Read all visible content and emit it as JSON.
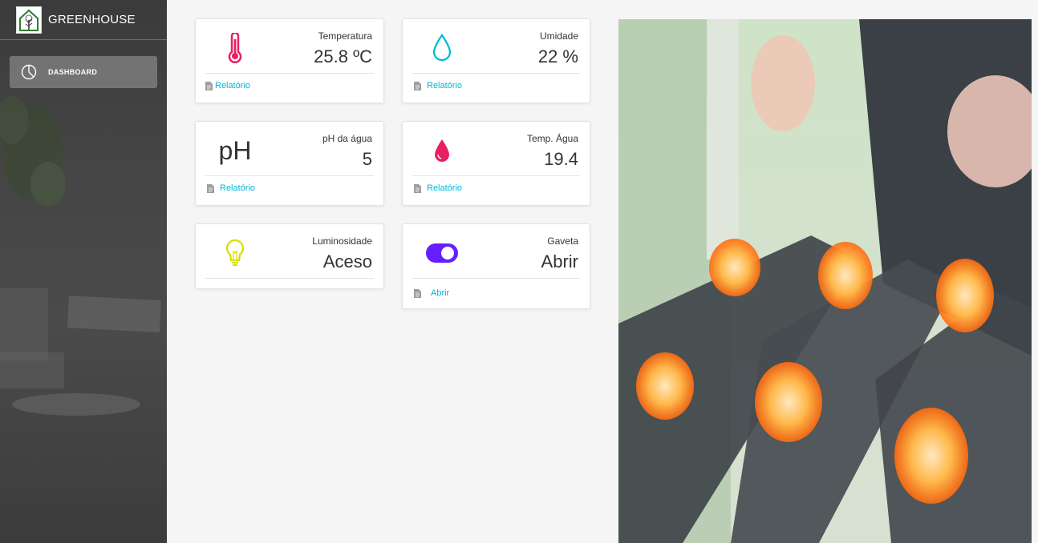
{
  "app": {
    "title": "GREENHOUSE"
  },
  "sidebar": {
    "items": [
      {
        "label": "DASHBOARD",
        "icon": "pie-chart-icon"
      }
    ]
  },
  "cards": {
    "temperature": {
      "title": "Temperatura",
      "value": "25.8 ºC",
      "link": "Relatório",
      "icon": "thermometer-icon",
      "color": "#e91e63"
    },
    "humidity": {
      "title": "Umidade",
      "value": "22 %",
      "link": "Relatório",
      "icon": "water-drop-icon",
      "color": "#00bcd4"
    },
    "ph": {
      "title": "pH da água",
      "value": "5",
      "icon_text": "pH",
      "link": "Relatório"
    },
    "water_temp": {
      "title": "Temp. Água",
      "value": "19.4",
      "link": "Relatório",
      "icon": "drop-icon",
      "color": "#e91e63"
    },
    "light": {
      "title": "Luminosidade",
      "value": "Aceso",
      "icon": "lightbulb-icon",
      "color": "#d4e000"
    },
    "drawer": {
      "title": "Gaveta",
      "value": "Abrir",
      "link": "Abrir",
      "icon": "toggle-icon",
      "color": "#651fff"
    }
  },
  "camera": {
    "label": "camera-feed"
  },
  "colors": {
    "link": "#00b8d8",
    "sidebar_bg": "#3f3f3f",
    "accent_purple": "#651fff"
  }
}
